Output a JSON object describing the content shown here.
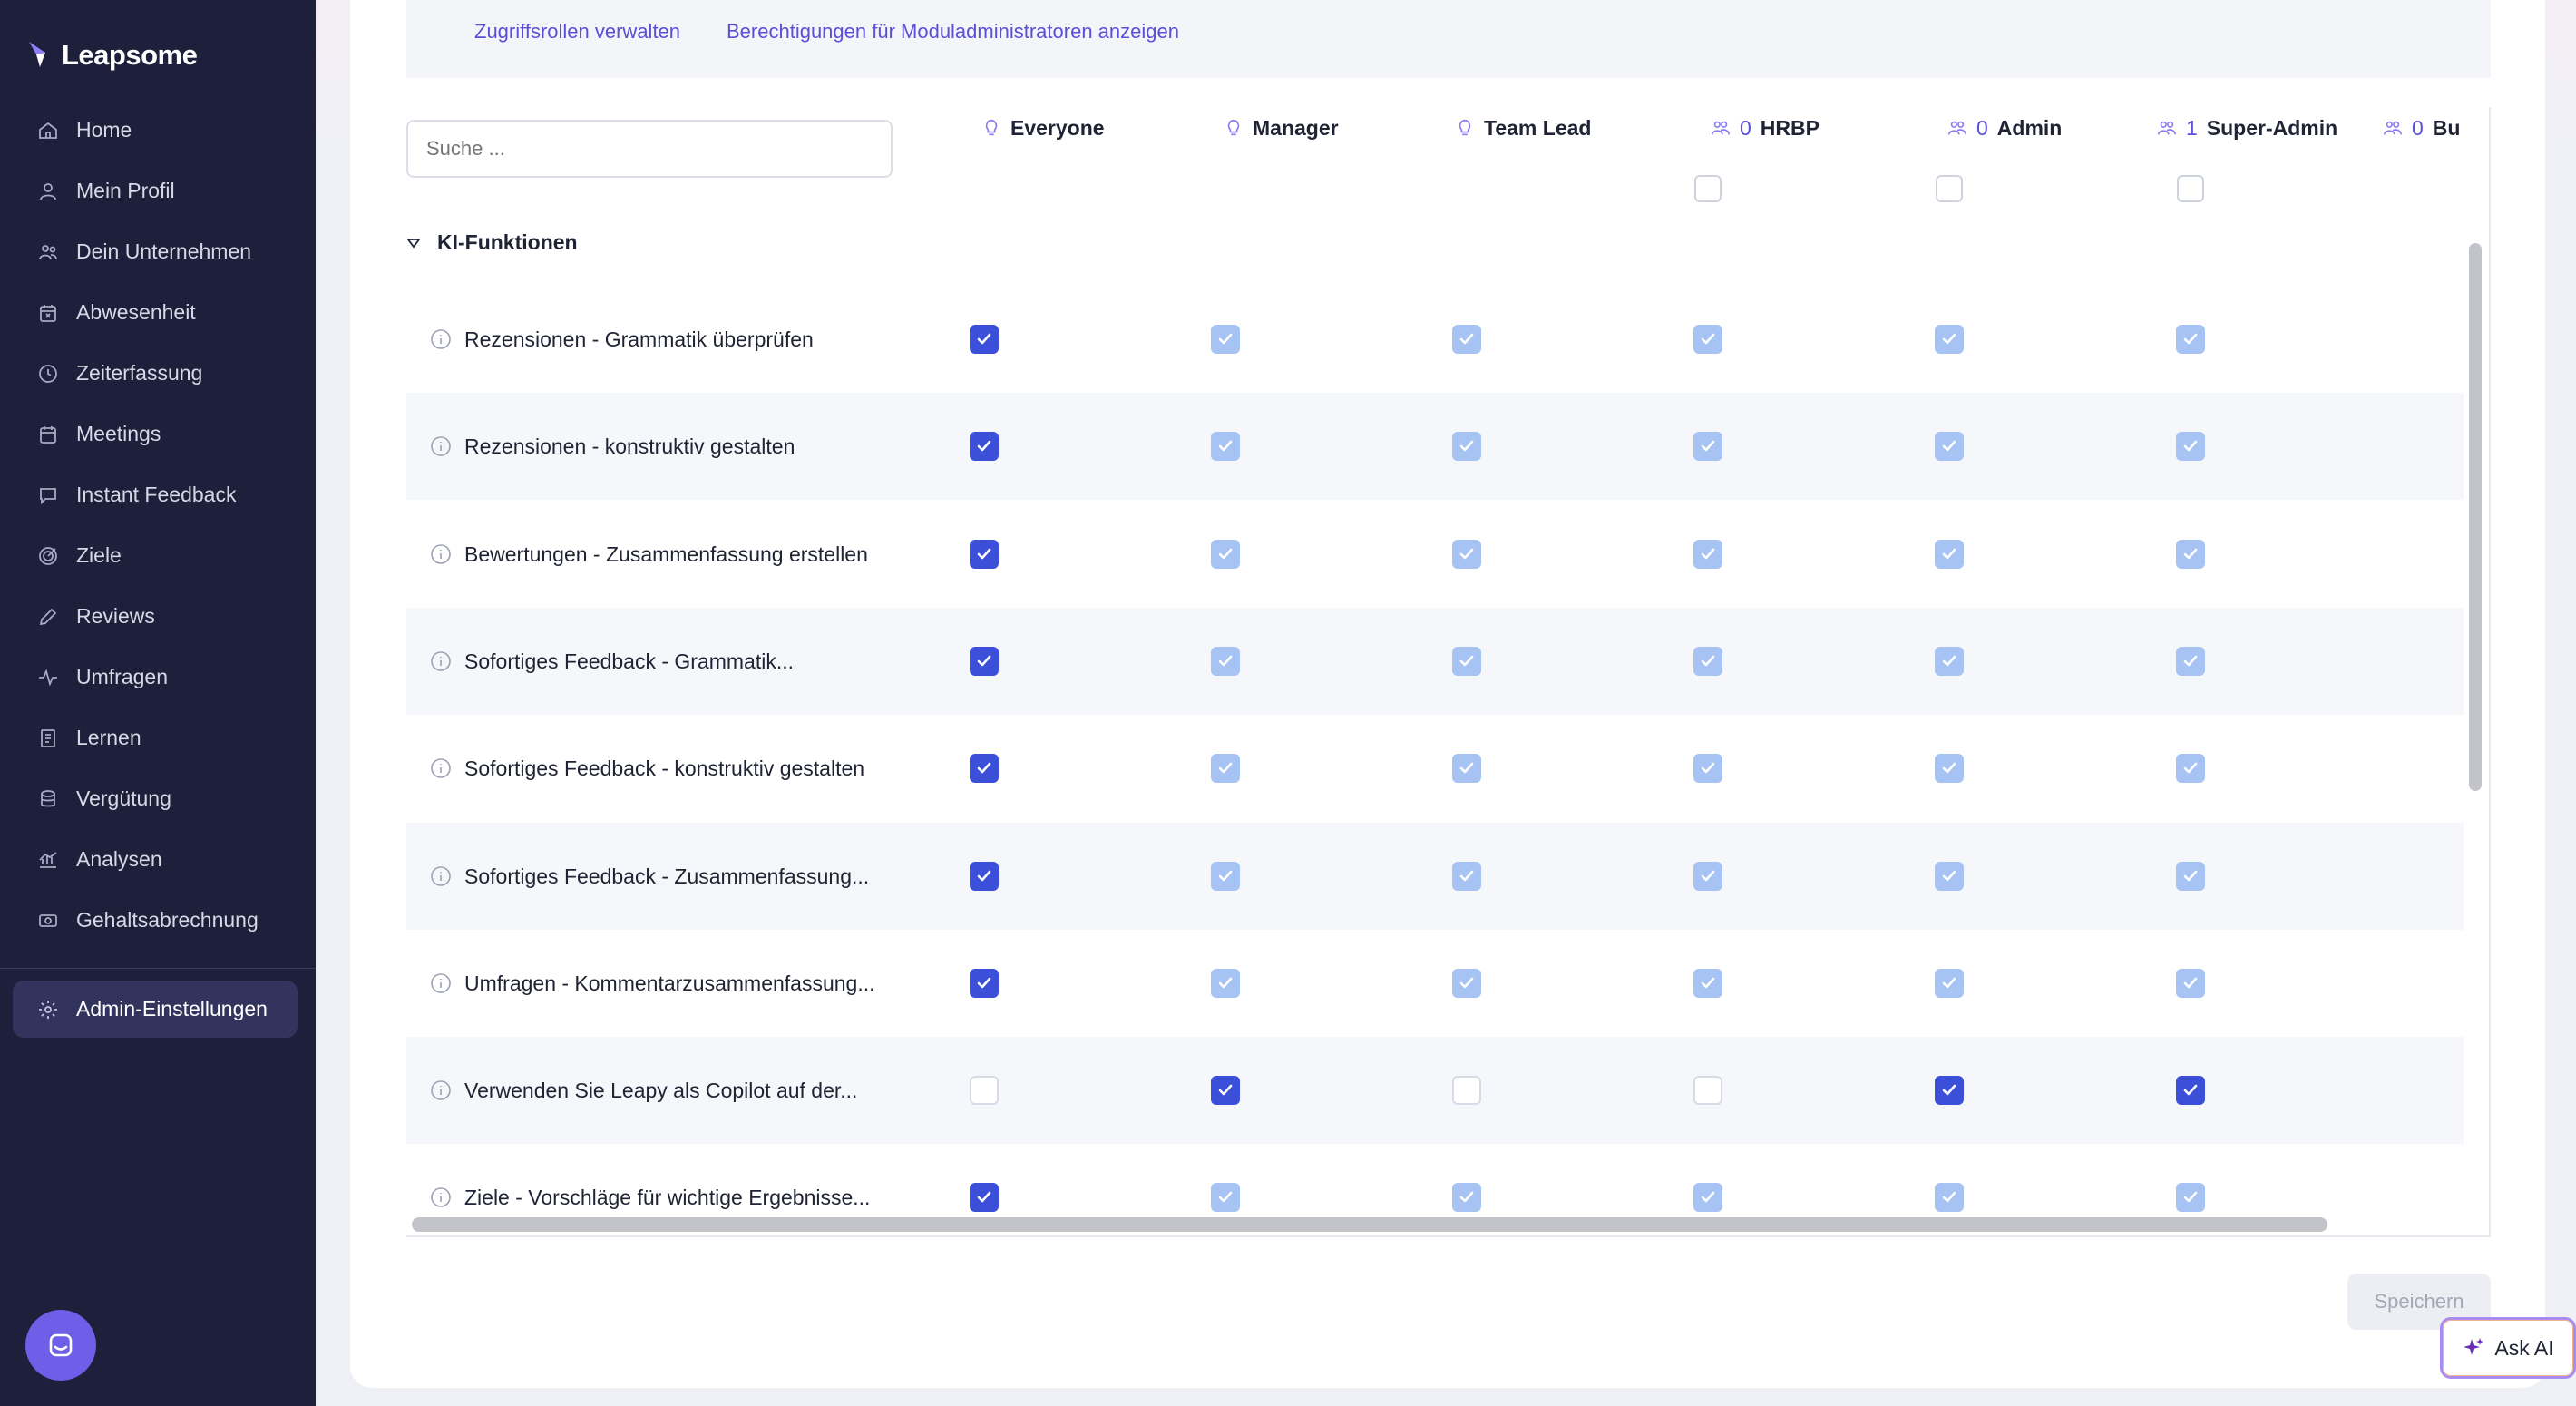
{
  "app": {
    "logo_text": "Leapsome"
  },
  "sidebar": {
    "items": [
      {
        "label": "Home",
        "icon": "home-icon"
      },
      {
        "label": "Mein Profil",
        "icon": "user-icon"
      },
      {
        "label": "Dein Unternehmen",
        "icon": "users-icon"
      },
      {
        "label": "Abwesenheit",
        "icon": "calendar-x-icon"
      },
      {
        "label": "Zeiterfassung",
        "icon": "clock-icon"
      },
      {
        "label": "Meetings",
        "icon": "calendar-icon"
      },
      {
        "label": "Instant Feedback",
        "icon": "chat-icon"
      },
      {
        "label": "Ziele",
        "icon": "target-icon"
      },
      {
        "label": "Reviews",
        "icon": "pencil-icon"
      },
      {
        "label": "Umfragen",
        "icon": "pulse-icon"
      },
      {
        "label": "Lernen",
        "icon": "book-icon"
      },
      {
        "label": "Vergütung",
        "icon": "coins-icon"
      },
      {
        "label": "Analysen",
        "icon": "chart-icon"
      },
      {
        "label": "Gehaltsabrechnung",
        "icon": "cash-icon"
      }
    ],
    "active": {
      "label": "Admin-Einstellungen",
      "icon": "gear-icon"
    }
  },
  "top_links": {
    "manage_roles": "Zugriffsrollen verwalten",
    "module_admins": "Berechtigungen für Moduladministratoren anzeigen"
  },
  "search": {
    "placeholder": "Suche ..."
  },
  "columns": [
    {
      "label": "Everyone",
      "icon": "lightbulb-icon",
      "count": ""
    },
    {
      "label": "Manager",
      "icon": "lightbulb-icon",
      "count": ""
    },
    {
      "label": "Team Lead",
      "icon": "lightbulb-icon",
      "count": ""
    },
    {
      "label": "HRBP",
      "icon": "group-icon",
      "count": "0"
    },
    {
      "label": "Admin",
      "icon": "group-icon",
      "count": "0"
    },
    {
      "label": "Super-Admin",
      "icon": "group-icon",
      "count": "1"
    },
    {
      "label": "Bu",
      "icon": "group-icon",
      "count": "0"
    }
  ],
  "section": {
    "title": "KI-Funktionen"
  },
  "rows": [
    {
      "label": "Rezensionen - Grammatik überprüfen",
      "states": [
        "on",
        "inh",
        "inh",
        "inh",
        "inh",
        "inh"
      ]
    },
    {
      "label": "Rezensionen - konstruktiv gestalten",
      "states": [
        "on",
        "inh",
        "inh",
        "inh",
        "inh",
        "inh"
      ]
    },
    {
      "label": "Bewertungen - Zusammenfassung erstellen",
      "states": [
        "on",
        "inh",
        "inh",
        "inh",
        "inh",
        "inh"
      ]
    },
    {
      "label": "Sofortiges Feedback - Grammatik...",
      "states": [
        "on",
        "inh",
        "inh",
        "inh",
        "inh",
        "inh"
      ]
    },
    {
      "label": "Sofortiges Feedback - konstruktiv gestalten",
      "states": [
        "on",
        "inh",
        "inh",
        "inh",
        "inh",
        "inh"
      ]
    },
    {
      "label": "Sofortiges Feedback - Zusammenfassung...",
      "states": [
        "on",
        "inh",
        "inh",
        "inh",
        "inh",
        "inh"
      ]
    },
    {
      "label": "Umfragen - Kommentarzusammenfassung...",
      "states": [
        "on",
        "inh",
        "inh",
        "inh",
        "inh",
        "inh"
      ]
    },
    {
      "label": "Verwenden Sie Leapy als Copilot auf der...",
      "states": [
        "off",
        "on",
        "off",
        "off",
        "on",
        "on"
      ]
    },
    {
      "label": "Ziele - Vorschläge für wichtige Ergebnisse...",
      "states": [
        "on",
        "inh",
        "inh",
        "inh",
        "inh",
        "inh"
      ]
    }
  ],
  "footer": {
    "save_label": "Speichern",
    "ask_ai_label": "Ask AI"
  },
  "colors": {
    "sidebar_bg": "#1e1f3b",
    "accent": "#5a4fd6",
    "checked": "#3b4fd8",
    "inherited": "#a6c3f3"
  }
}
